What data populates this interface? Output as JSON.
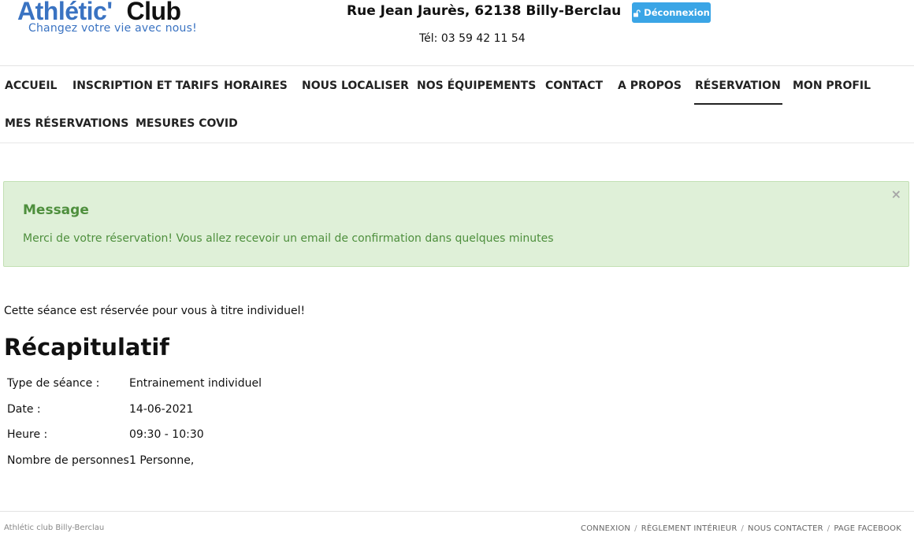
{
  "header": {
    "logo_part1": "Athlétic'",
    "logo_part2": "Club",
    "slogan": "Changez votre vie avec nous!",
    "address": "Rue Jean Jaurès, 62138 Billy-Berclau",
    "phone": "Tél: 03 59 42 11 54",
    "logout_label": "Déconnexion",
    "logout_icon": "unlock-icon"
  },
  "nav": {
    "items": [
      {
        "label": "ACCUEIL"
      },
      {
        "label": "INSCRIPTION ET TARIFS"
      },
      {
        "label": "HORAIRES"
      },
      {
        "label": "NOUS LOCALISER"
      },
      {
        "label": "NOS ÉQUIPEMENTS"
      },
      {
        "label": "CONTACT"
      },
      {
        "label": "A PROPOS"
      },
      {
        "label": "RÉSERVATION"
      },
      {
        "label": "MON PROFIL"
      },
      {
        "label": "MES RÉSERVATIONS"
      },
      {
        "label": "MESURES COVID"
      }
    ],
    "active": "RÉSERVATION"
  },
  "alert": {
    "title": "Message",
    "text": "Merci de votre réservation! Vous allez recevoir un email de confirmation dans quelques minutes",
    "close": "×",
    "bg_color": "#dff0d8",
    "text_color": "#4e8f3d"
  },
  "main": {
    "notice": "Cette séance est réservée pour vous à titre individuel!",
    "recap_title": "Récapitulatif",
    "recap": [
      {
        "label": "Type de séance :",
        "value": "Entrainement individuel"
      },
      {
        "label": "Date :",
        "value": "14-06-2021"
      },
      {
        "label": "Heure :",
        "value": "09:30 - 10:30"
      },
      {
        "label": "Nombre de personnes",
        "value": "1 Personne,"
      }
    ]
  },
  "footer": {
    "left": "Athlétic club Billy-Berclau",
    "links": [
      "CONNEXION",
      "RÈGLEMENT INTÉRIEUR",
      "NOUS CONTACTER",
      "PAGE FACEBOOK"
    ],
    "separator": "/"
  },
  "colors": {
    "brand_blue": "#3a73c2",
    "button_blue": "#3aa5e6"
  }
}
